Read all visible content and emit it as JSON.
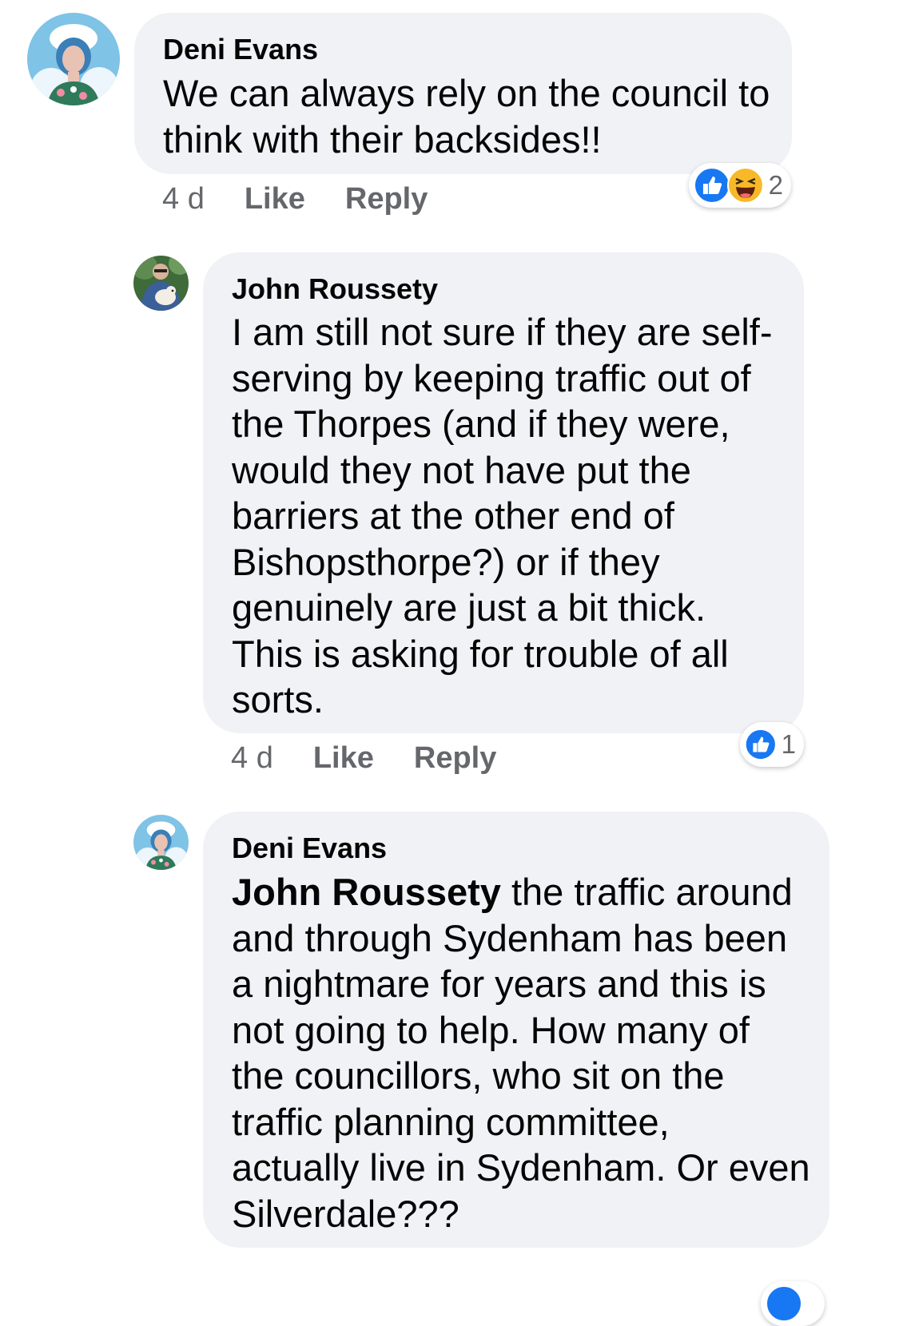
{
  "comments": [
    {
      "author": "Deni Evans",
      "lines": [
        "We can always rely on the council to",
        "think with their backsides!!"
      ],
      "time": "4 d",
      "like_label": "Like",
      "reply_label": "Reply",
      "reactions": [
        "like",
        "haha"
      ],
      "reaction_count": "2"
    },
    {
      "author": "John Roussety",
      "lines": [
        "I am still not sure if they are self-",
        "serving by keeping traffic out of",
        "the Thorpes (and if they were,",
        "would they not have put the",
        "barriers at the other end of",
        "Bishopsthorpe?) or if they",
        "genuinely are just a bit thick.",
        "This is asking for trouble of all",
        "sorts."
      ],
      "time": "4 d",
      "like_label": "Like",
      "reply_label": "Reply",
      "reactions": [
        "like"
      ],
      "reaction_count": "1"
    },
    {
      "author": "Deni Evans",
      "mention": "John Roussety",
      "first_line_rest": " the traffic around",
      "lines": [
        "and through Sydenham has been",
        "a nightmare for years and this is",
        "not going to help. How many of",
        "the councillors,  who sit on the",
        "traffic planning committee,",
        "actually live in Sydenham. Or even",
        "Silverdale???"
      ]
    }
  ],
  "colors": {
    "bubble": "#f0f2f5",
    "meta_text": "#65676b",
    "like_blue": "#1877f2",
    "haha_yellow": "#f7b928"
  }
}
